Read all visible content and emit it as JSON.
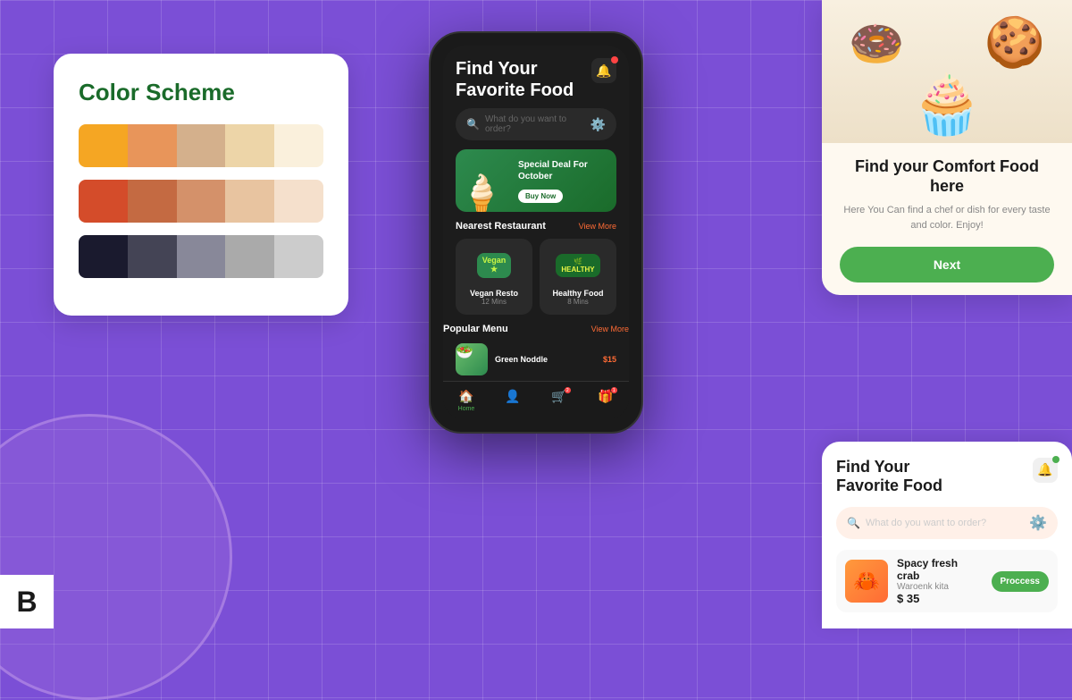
{
  "background": {
    "color": "#7B4FD6",
    "grid_color": "rgba(255,255,255,0.15)"
  },
  "color_scheme_card": {
    "title": "Color Scheme",
    "rows": [
      [
        "#F5A623",
        "#E8955A",
        "#D4B08C",
        "#EDD5A8",
        "#FAF0DC"
      ],
      [
        "#D44C2A",
        "#C46A42",
        "#D4916A",
        "#E8C4A0",
        "#F5E0CC"
      ],
      [
        "#1A1A2E",
        "#444455",
        "#888899",
        "#AAAAAA",
        "#CCCCCC"
      ]
    ]
  },
  "phone": {
    "title_line1": "Find Your",
    "title_line2": "Favorite Food",
    "search_placeholder": "What do you want to order?",
    "promo": {
      "title_line1": "Special Deal For",
      "title_line2": "October",
      "button_label": "Buy Now"
    },
    "nearest_restaurant": {
      "section_title": "Nearest Restaurant",
      "view_more_label": "View More",
      "items": [
        {
          "name": "Vegan Resto",
          "time": "12 Mins",
          "logo_text": "Vegan"
        },
        {
          "name": "Healthy Food",
          "time": "8 Mins",
          "logo_text": "HEALTHY"
        }
      ]
    },
    "popular_menu": {
      "section_title": "Popular Menu",
      "view_more_label": "View More",
      "items": [
        {
          "name": "Green Noddle",
          "price": "$15"
        }
      ]
    },
    "nav": [
      {
        "label": "Home",
        "icon": "🏠",
        "active": true
      },
      {
        "label": "",
        "icon": "👤",
        "active": false
      },
      {
        "label": "",
        "icon": "🛒",
        "active": false,
        "badge": "2",
        "badge_color": "#ff4444"
      },
      {
        "label": "",
        "icon": "🎁",
        "active": false,
        "badge": "1",
        "badge_color": "#ff4444"
      }
    ]
  },
  "comfort_card": {
    "image_emoji": "🧁",
    "title": "Find your  Comfort Food here",
    "description": "Here You Can find a chef or dish for every taste and color. Enjoy!",
    "button_label": "Next"
  },
  "fav_card": {
    "title_line1": "Find Your",
    "title_line2": "Favorite Food",
    "search_placeholder": "What do you want to order?",
    "order": {
      "name": "Spacy fresh crab",
      "place": "Waroenk kita",
      "price": "$ 35",
      "button_label": "Proccess",
      "emoji": "🦀"
    }
  },
  "b_badge_label": "B"
}
